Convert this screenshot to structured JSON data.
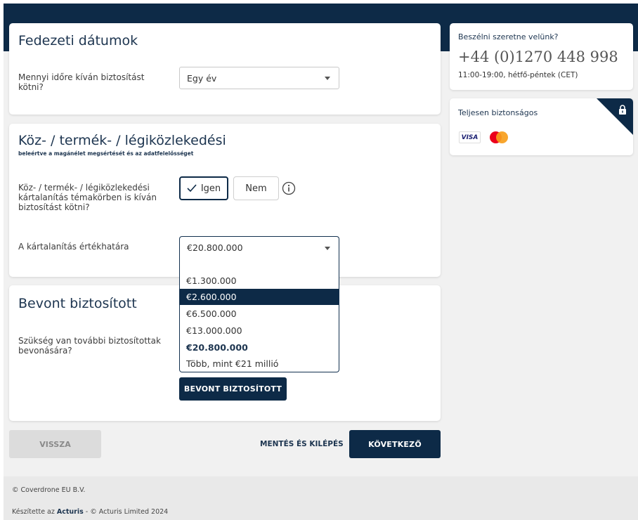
{
  "coverage_dates": {
    "title": "Fedezeti dátumok",
    "question": "Mennyi időre kíván biztosítást kötni?",
    "selected": "Egy év"
  },
  "liability": {
    "title": "Köz- / termék- / légiközlekedési",
    "subtitle": "beleértve a magánélet megsértését és az adatfelelősséget",
    "question": "Köz- / termék- / légiközlekedési kártalanítás témakörben is kíván biztosítást kötni?",
    "yes_label": "Igen",
    "no_label": "Nem",
    "yes_selected": true,
    "limit_label": "A kártalanítás értékhatára",
    "limit_selected": "€20.800.000",
    "options": [
      "€1.300.000",
      "€2.600.000",
      "€6.500.000",
      "€13.000.000",
      "€20.800.000",
      "Több, mint €21 millió"
    ],
    "highlighted_option": "€2.600.000",
    "bold_option": "€20.800.000"
  },
  "insured": {
    "title": "Bevont biztosított",
    "question": "Szükség van további biztosítottak bevonására?",
    "button_label": "BEVONT BIZTOSÍTOTT"
  },
  "nav": {
    "back_label": "VISSZA",
    "save_exit_label": "MENTÉS ÉS KILÉPÉS",
    "next_label": "KÖVETKEZŐ"
  },
  "contact": {
    "title": "Beszélni szeretne velünk?",
    "phone": "+44 (0)1270 448 998",
    "hours": "11:00-19:00, hétfő-péntek (CET)"
  },
  "security": {
    "title": "Teljesen biztonságos",
    "visa_label": "VISA"
  },
  "footer": {
    "copyright": "© Coverdrone EU B.V.",
    "made_by_prefix": "Készítette az ",
    "made_by_brand": "Acturis",
    "made_by_suffix": " - © Acturis Limited 2024"
  },
  "colors": {
    "navy": "#0d2a47",
    "background": "#f1f1f1",
    "mastercard_red": "#eb001b",
    "mastercard_yellow": "#f79e1b"
  },
  "icons": [
    "info-icon",
    "checkmark-icon",
    "lock-icon",
    "caret-down-icon"
  ]
}
